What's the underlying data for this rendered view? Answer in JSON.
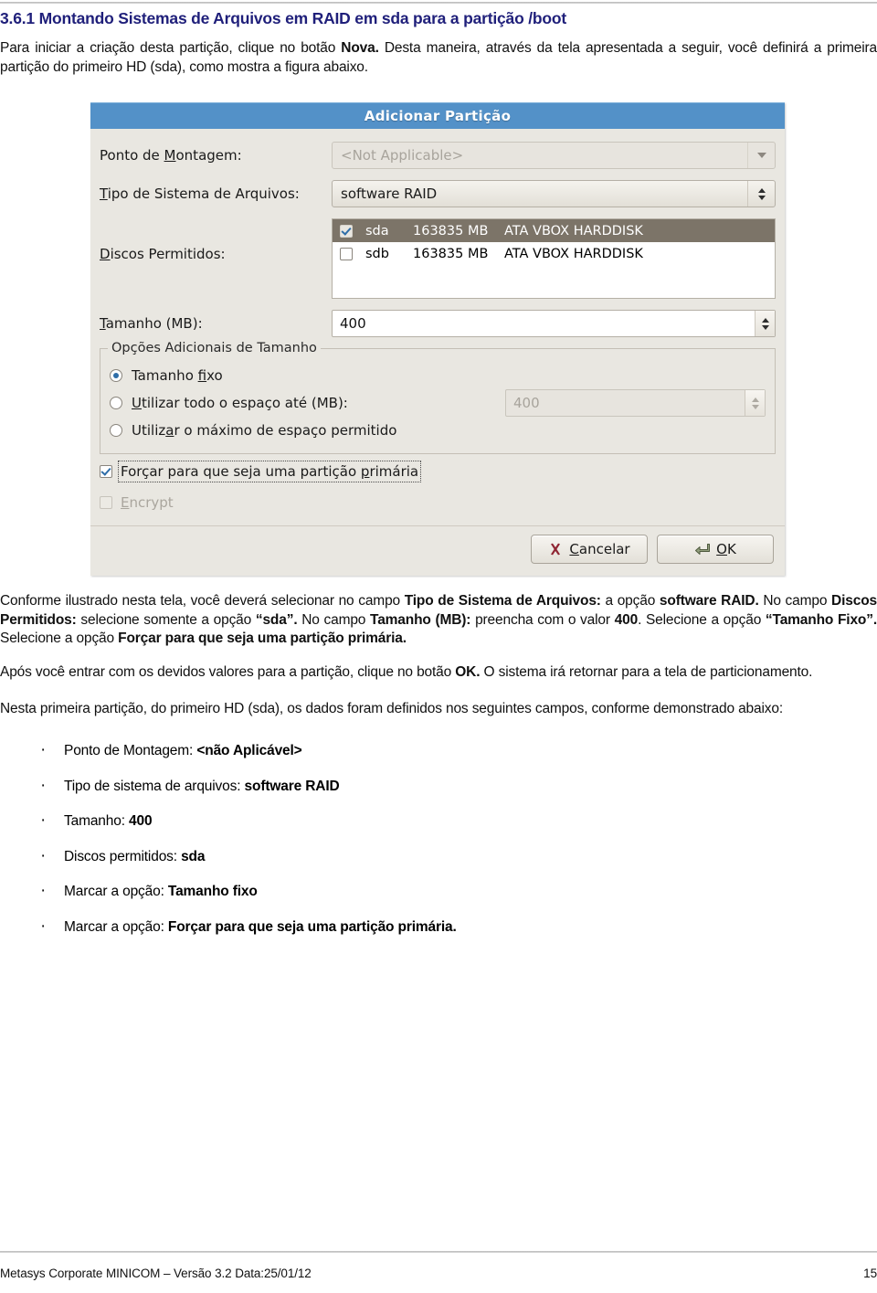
{
  "document": {
    "section_number": "3.6.1",
    "section_title": "3.6.1 Montando Sistemas de Arquivos em RAID em sda para a partição /boot",
    "intro_html": "Para iniciar a criação desta partição, clique no botão <b>Nova.</b> Desta maneira, através da tela apresentada a seguir, você definirá a primeira partição do primeiro HD (sda), como mostra a figura abaixo.",
    "after_fig_html": "Conforme ilustrado nesta tela, você deverá selecionar no campo <b>Tipo de Sistema de Arquivos:</b> a opção <b>software RAID.</b> No campo <b>Discos Permitidos:</b> selecione somente a opção <b>“sda”.</b> No campo <b>Tamanho (MB):</b> preencha com o valor <b>400</b>. Selecione a opção <b>“Tamanho Fixo”.</b> Selecione a opção <b>Forçar para que seja uma partição primária.</b>",
    "ok_paragraph_html": "Após você entrar com os devidos valores para a partição, clique no botão <b>OK.</b> O sistema irá retornar para a tela de particionamento.",
    "summary_intro_html": "Nesta primeira partição, do primeiro HD (sda), os dados foram definidos nos seguintes campos, conforme demonstrado abaixo:",
    "bullets": [
      "Ponto de Montagem: <b>&lt;não Aplicável&gt;</b>",
      "Tipo de sistema de arquivos: <b>software RAID</b>",
      "Tamanho: <b>400</b>",
      "Discos permitidos: <b>sda</b>",
      "Marcar a opção: <b>Tamanho fixo</b>",
      "Marcar a opção: <b>Forçar para que seja uma partição primária.</b>"
    ],
    "footer": {
      "left": "Metasys Corporate MINICOM – Versão 3.2 Data:25/01/12",
      "page_number": "15"
    },
    "colors": {
      "heading": "#1f1f7a",
      "dialog_titlebar": "#5391c8",
      "dialog_background": "#e9e7e1",
      "list_selection": "#7c7468",
      "check_accent": "#2f6ea8",
      "cancel_icon": "#8f2533",
      "ok_icon": "#7d8a6a"
    }
  },
  "dialog": {
    "title": "Adicionar Partição",
    "fields": {
      "mount_point": {
        "label_prefix": "Ponto de ",
        "label_mnemonic": "M",
        "label_suffix": "ontagem:",
        "value": "<Not Applicable>",
        "enabled": false,
        "arrow_icon": "chevron-down-icon"
      },
      "filesystem_type": {
        "label_mnemonic": "T",
        "label_suffix": "ipo de Sistema de Arquivos:",
        "value": "software RAID",
        "enabled": true,
        "arrow_icon": "updown-arrows-icon"
      },
      "allowed_drives": {
        "label_mnemonic": "D",
        "label_suffix": "iscos Permitidos:",
        "rows": [
          {
            "checked": true,
            "selected": true,
            "name": "sda",
            "size": "163835 MB",
            "model": "ATA VBOX HARDDISK"
          },
          {
            "checked": false,
            "selected": false,
            "name": "sdb",
            "size": "163835 MB",
            "model": "ATA VBOX HARDDISK"
          }
        ]
      },
      "size_mb": {
        "label_mnemonic": "T",
        "label_suffix": "amanho (MB):",
        "value": "400",
        "enabled": true,
        "spinner_icon": "spinner-arrows-icon"
      }
    },
    "size_options_group": {
      "legend": "Opções Adicionais de Tamanho",
      "options": [
        {
          "selected": true,
          "label_pre": "Tamanho ",
          "label_mnemonic": "f",
          "label_post": "ixo",
          "has_entry": false
        },
        {
          "selected": false,
          "label_pre": "",
          "label_mnemonic": "U",
          "label_post": "tilizar todo o espaço até (MB):",
          "has_entry": true,
          "entry_value": "400",
          "entry_enabled": false
        },
        {
          "selected": false,
          "label_pre": "Utiliz",
          "label_mnemonic": "a",
          "label_post": "r o máximo de espaço permitido",
          "has_entry": false
        }
      ]
    },
    "checkboxes": [
      {
        "name": "force-primary",
        "checked": true,
        "enabled": true,
        "focused": true,
        "label_pre": "Forçar para que seja uma partição ",
        "label_mnemonic": "p",
        "label_post": "rimária"
      },
      {
        "name": "encrypt",
        "checked": false,
        "enabled": false,
        "focused": false,
        "label_pre": "",
        "label_mnemonic": "E",
        "label_post": "ncrypt"
      }
    ],
    "buttons": [
      {
        "name": "cancel",
        "icon": "x-mark-icon",
        "label_pre": "",
        "label_mnemonic": "C",
        "label_post": "ancelar"
      },
      {
        "name": "ok",
        "icon": "enter-arrow-icon",
        "label_pre": "",
        "label_mnemonic": "O",
        "label_post": "K"
      }
    ]
  }
}
